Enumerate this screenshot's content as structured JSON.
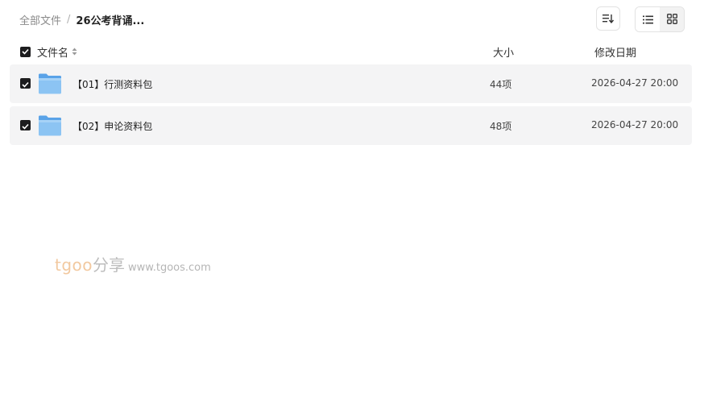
{
  "breadcrumb": {
    "root": "全部文件",
    "separator": "/",
    "current": "26公考背诵..."
  },
  "toolbar": {
    "sort_icon": "sort-icon",
    "list_view_icon": "list-view-icon",
    "grid_view_icon": "grid-view-icon"
  },
  "columns": {
    "name": "文件名",
    "size": "大小",
    "modified": "修改日期"
  },
  "files": [
    {
      "name": "【01】行测资料包",
      "size": "44项",
      "modified": "2026-04-27 20:00",
      "checked": true
    },
    {
      "name": "【02】申论资料包",
      "size": "48项",
      "modified": "2026-04-27 20:00",
      "checked": true
    }
  ],
  "watermark": {
    "brand": "tgoo",
    "cn": "分享",
    "url": "www.tgoos.com"
  },
  "colors": {
    "checkbox": "#1d1d1f",
    "row_bg": "#f4f4f5",
    "folder": "#7fbbf0"
  }
}
